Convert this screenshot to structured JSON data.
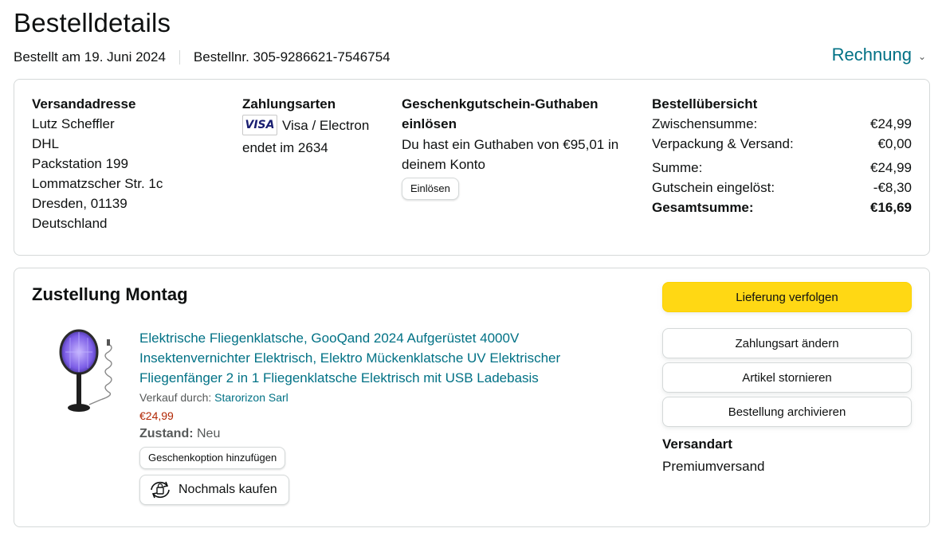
{
  "header": {
    "title": "Bestelldetails",
    "ordered_on": "Bestellt am 19. Juni 2024",
    "order_number": "Bestellnr. 305-9286621-7546754",
    "invoice_label": "Rechnung"
  },
  "address": {
    "title": "Versandadresse",
    "lines": [
      "Lutz Scheffler",
      "DHL",
      "Packstation 199",
      "Lommatzscher Str. 1c",
      "Dresden, 01139",
      "Deutschland"
    ]
  },
  "payment": {
    "title": "Zahlungsarten",
    "card_logo": "VISA",
    "card_type": "Visa / Electron",
    "ending": "endet im 2634"
  },
  "giftcard": {
    "title": "Geschenkgutschein-Guthaben einlösen",
    "balance_text": "Du hast ein Guthaben von €95,01 in deinem Konto",
    "redeem_label": "Einlösen"
  },
  "summary": {
    "title": "Bestellübersicht",
    "rows": [
      {
        "label": "Zwischensumme:",
        "value": "€24,99"
      },
      {
        "label": "Verpackung & Versand:",
        "value": "€0,00"
      },
      {
        "label": "Summe:",
        "value": "€24,99"
      },
      {
        "label": "Gutschein eingelöst:",
        "value": "-€8,30"
      },
      {
        "label": "Gesamtsumme:",
        "value": "€16,69"
      }
    ]
  },
  "delivery": {
    "title": "Zustellung Montag",
    "product": {
      "title": "Elektrische Fliegenklatsche, GooQand 2024 Aufgerüstet 4000V Insektenvernichter Elektrisch, Elektro Mückenklatsche UV Elektrischer Fliegenfänger 2 in 1 Fliegenklatsche Elektrisch mit USB Ladebasis",
      "seller_label": "Verkauf durch:",
      "seller_name": "Starorizon Sarl",
      "price": "€24,99",
      "condition_label": "Zustand:",
      "condition_value": "Neu",
      "gift_option_label": "Geschenkoption hinzufügen",
      "buy_again_label": "Nochmals kaufen"
    },
    "actions": {
      "track": "Lieferung verfolgen",
      "change_payment": "Zahlungsart ändern",
      "cancel": "Artikel stornieren",
      "archive": "Bestellung archivieren"
    },
    "shipping": {
      "title": "Versandart",
      "value": "Premiumversand"
    }
  },
  "colors": {
    "link": "#007185",
    "primary_button": "#ffd814",
    "price": "#b12704",
    "border": "#d5d9d9"
  }
}
